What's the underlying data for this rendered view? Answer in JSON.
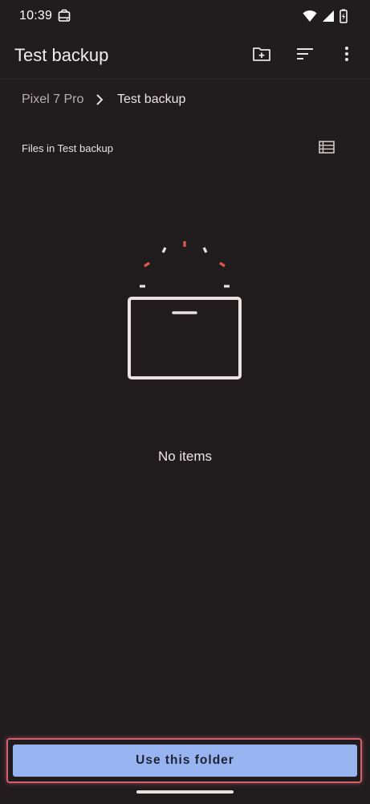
{
  "status_bar": {
    "time": "10:39",
    "notification_icon": "drive-icon",
    "icons": [
      "wifi-icon",
      "signal-icon",
      "battery-charging-icon"
    ]
  },
  "app_bar": {
    "title": "Test backup",
    "actions": [
      "new-folder-icon",
      "sort-icon",
      "more-vert-icon"
    ]
  },
  "breadcrumb": {
    "root": "Pixel 7 Pro",
    "separator_icon": "chevron-right-icon",
    "current": "Test backup"
  },
  "content": {
    "section_label": "Files in Test backup",
    "view_toggle_icon": "list-view-icon",
    "empty_illustration": "empty-folder-illustration",
    "empty_text": "No items"
  },
  "footer": {
    "button_label": "Use this folder",
    "button_color": "#97b4f0",
    "highlight_color": "#d4606f"
  },
  "colors": {
    "background": "#211d1e",
    "text": "#e8e2e2",
    "accent_red": "#e0574f"
  }
}
